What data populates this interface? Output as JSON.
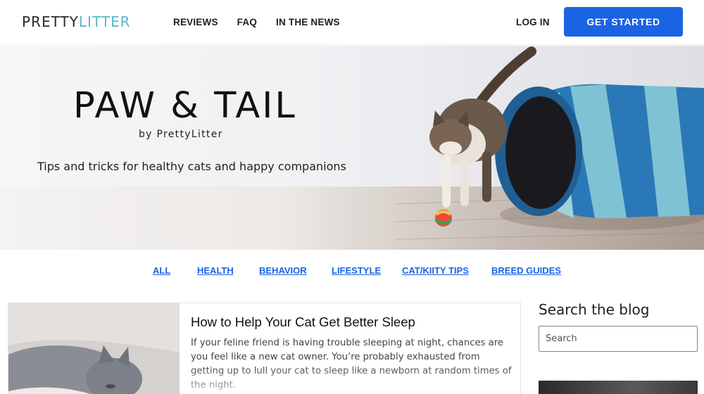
{
  "header": {
    "logo": {
      "part1": "PRETTY",
      "part2": "LITTER"
    },
    "nav": [
      "REVIEWS",
      "FAQ",
      "IN THE NEWS"
    ],
    "login": "LOG IN",
    "cta": "GET STARTED"
  },
  "hero": {
    "title": "PAW & TAIL",
    "byline": "by PrettyLitter",
    "tagline": "Tips and tricks for healthy cats and happy companions"
  },
  "categories": [
    "ALL",
    "HEALTH",
    "BEHAVIOR",
    "LIFESTYLE",
    "CAT/KIITY TIPS",
    "BREED GUIDES"
  ],
  "article": {
    "title": "How to Help Your Cat Get Better Sleep",
    "excerpt": "If your feline friend is having trouble sleeping at night, chances are you feel like a new cat owner. You’re probably exhausted from getting up to lull your cat to sleep like a newborn at random times of the night."
  },
  "sidebar": {
    "title": "Search the blog",
    "search_placeholder": "Search"
  },
  "colors": {
    "accent": "#1a63e3",
    "logo_accent": "#5fb6c9"
  }
}
